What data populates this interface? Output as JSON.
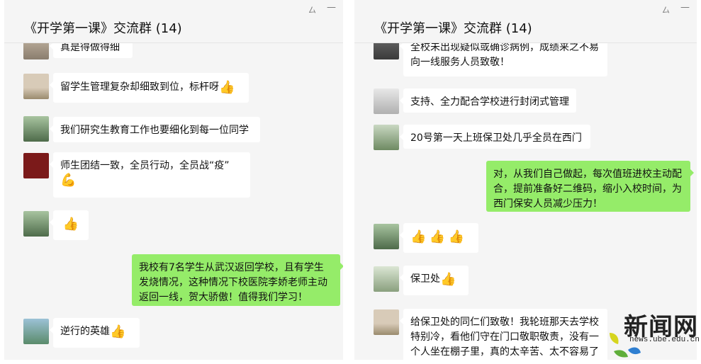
{
  "left": {
    "title": "《开学第一课》交流群 (14)",
    "pin_icon": "pin-icon",
    "minimize_icon": "minimize-icon",
    "messages": [
      {
        "text": "真是得做得细"
      },
      {
        "text": "留学生管理复杂却细致到位，标杆呀"
      },
      {
        "text": "我们研究生教育工作也要细化到每一位同学"
      },
      {
        "text": "师生团结一致，全员行动，全员战“疫”"
      },
      {
        "text": ""
      },
      {
        "text": "我校有7名学生从武汉返回学校，且有学生发烧情况，这种情况下校医院李娇老师主动返回一线，贺大骄傲！值得我们学习！"
      },
      {
        "text": "逆行的英雄"
      }
    ]
  },
  "right": {
    "title": "《开学第一课》交流群 (14)",
    "pin_icon": "pin-icon",
    "minimize_icon": "minimize-icon",
    "messages": [
      {
        "text": "全校未出现疑似或确诊病例，成绩来之不易向一线服务人员致敬！"
      },
      {
        "text": "支持、全力配合学校进行封闭式管理"
      },
      {
        "text": "20号第一天上班保卫处几乎全员在西门"
      },
      {
        "text": "对，从我们自己做起，每次值班进校主动配合，提前准备好二维码，缩小入校时间，为西门保安人员减少压力！"
      },
      {
        "text": ""
      },
      {
        "text": "保卫处"
      },
      {
        "text": "给保卫处的同仁们致敬！我轮班那天去学校特别冷，看他们守在门口敬职敬责，没有一个人坐在棚子里，真的太辛苦、太不容易了"
      }
    ]
  },
  "emoji": {
    "thumbs_up": "👍",
    "flexed_biceps": "💪"
  },
  "watermark": {
    "title": "新闻网",
    "url": "news.ube.edu.cn"
  },
  "colors": {
    "my_bubble": "#95ec69",
    "other_bubble": "#ffffff",
    "panel_bg": "#f5f5f5"
  }
}
